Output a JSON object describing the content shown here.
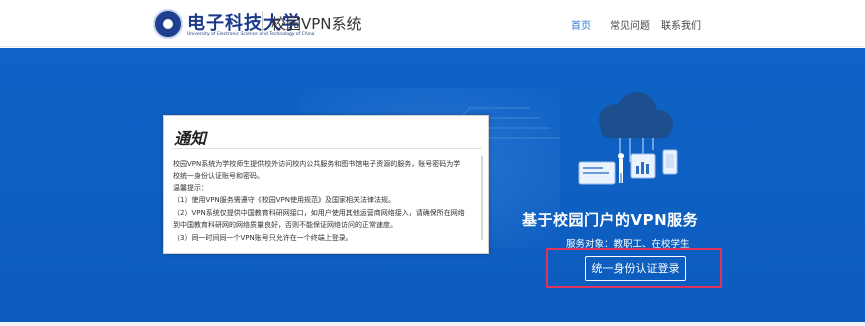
{
  "header": {
    "university_name": "电子科技大学",
    "university_name_en": "University of Electronic Science and Technology of China",
    "system_title": "校园VPN系统",
    "nav": [
      {
        "label": "首页",
        "active": true
      },
      {
        "label": "常见问题",
        "active": false
      },
      {
        "label": "联系我们",
        "active": false
      }
    ]
  },
  "notice": {
    "title": "通知",
    "lines": [
      "校园VPN系统为学校师生提供校外访问校内公共服务和图书馆电子资源的服务，账号密码为学",
      "校统一身份认证账号和密码。",
      "温馨提示：",
      "（1）使用VPN服务需遵守《校园VPN使用规范》及国家相关法律法规。",
      "（2）VPN系统仅提供中国教育科研网接口，如用户使用其他运营商网络接入，请确保所在网络",
      "到中国教育科研网的网络质量良好，否则不能保证网络访问的正常速度。",
      "（3）同一时间同一个VPN账号只允许在一个终端上登录。"
    ]
  },
  "hero": {
    "slogan": "基于校园门户的VPN服务",
    "service_target": "服务对象：教职工、在校学生",
    "login_button": "统一身份认证登录"
  },
  "colors": {
    "hero_blue": "#0f63c6",
    "nav_active": "#2e7ad6",
    "highlight_red": "#e0325a"
  }
}
